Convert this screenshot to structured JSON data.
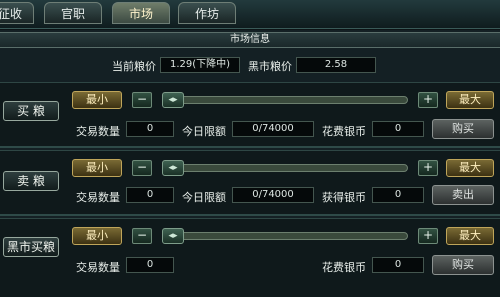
{
  "tabs": [
    {
      "label": "征收"
    },
    {
      "label": "官职"
    },
    {
      "label": "市场"
    },
    {
      "label": "作坊"
    }
  ],
  "panel_title": "市场信息",
  "prices": {
    "current_label": "当前粮价",
    "current_value": "1.29(下降中)",
    "black_label": "黑市粮价",
    "black_value": "2.58"
  },
  "sections": [
    {
      "side_button": "买 粮",
      "min_label": "最小",
      "max_label": "最大",
      "minus": "−",
      "plus": "+",
      "thumb": "◂▸",
      "qty_label": "交易数量",
      "qty_value": "0",
      "limit_label": "今日限额",
      "limit_value": "0/74000",
      "cost_label": "花费银币",
      "cost_value": "0",
      "action": "购买"
    },
    {
      "side_button": "卖 粮",
      "min_label": "最小",
      "max_label": "最大",
      "minus": "−",
      "plus": "+",
      "thumb": "◂▸",
      "qty_label": "交易数量",
      "qty_value": "0",
      "limit_label": "今日限额",
      "limit_value": "0/74000",
      "cost_label": "获得银币",
      "cost_value": "0",
      "action": "卖出"
    },
    {
      "side_button": "黑市买粮",
      "min_label": "最小",
      "max_label": "最大",
      "minus": "−",
      "plus": "+",
      "thumb": "◂▸",
      "qty_label": "交易数量",
      "qty_value": "0",
      "cost_label": "花费银币",
      "cost_value": "0",
      "action": "购买"
    }
  ]
}
